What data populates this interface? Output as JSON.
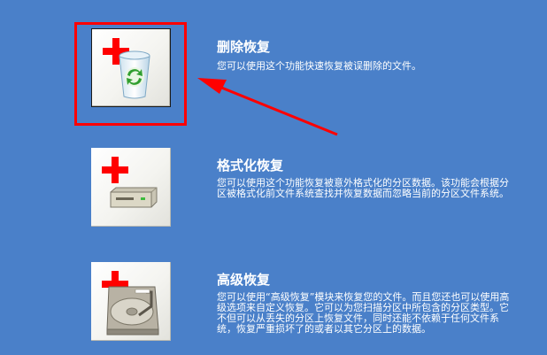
{
  "items": [
    {
      "title": "删除恢复",
      "desc": "您可以使用这个功能快速恢复被误删除的文件。",
      "icon": "recycle-bin-icon"
    },
    {
      "title": "格式化恢复",
      "desc": "您可以使用这个功能恢复被意外格式化的分区数据。该功能会根据分区被格式化前文件系统查找并恢复数据而忽略当前的分区文件系统。",
      "icon": "disk-drive-icon"
    },
    {
      "title": "高级恢复",
      "desc": "您可以使用“高级恢复”模块来恢复您的文件。而且您还也可以使用高级选项来自定义恢复。它可以为您扫描分区中所包含的分区类型。它不但可以从丢失的分区上恢复文件，同时还能不依赖于任何文件系统，恢复严重损坏了的或者以其它分区上的数据。",
      "icon": "hard-disk-icon"
    }
  ],
  "colors": {
    "background": "#4a80c9",
    "highlight": "#ff0000",
    "plus": "#ff0000"
  }
}
